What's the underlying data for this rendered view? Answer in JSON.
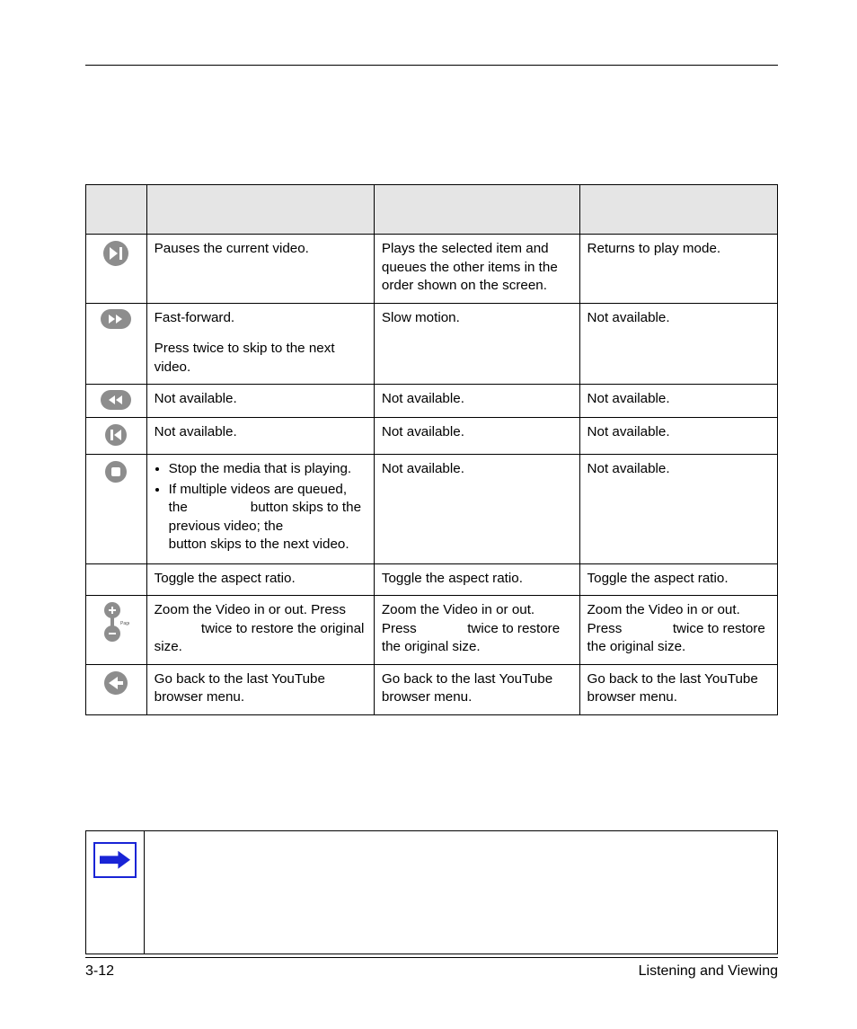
{
  "footer": {
    "page_num": "3-12",
    "section": "Listening and Viewing"
  },
  "table": {
    "rows": [
      {
        "icon": "play-pause",
        "c2_p1": "Pauses the current video.",
        "c3": "Plays the selected item and queues the other items in the order shown on the screen.",
        "c4": "Returns to play mode."
      },
      {
        "icon": "fast-forward",
        "c2_p1": "Fast-forward.",
        "c2_p2": "Press twice to skip to the next video.",
        "c3": "Slow motion.",
        "c4": "Not available."
      },
      {
        "icon": "rewind",
        "c2_p1": "Not available.",
        "c3": "Not available.",
        "c4": "Not available."
      },
      {
        "icon": "skip-prev",
        "c2_p1": "Not available.",
        "c3": "Not available.",
        "c4": "Not available."
      },
      {
        "icon": "stop",
        "c2_bullets": {
          "b1": "Stop the media that is playing.",
          "b2_a": "If multiple videos are queued, the",
          "b2_b": "button skips to the previous video; the",
          "b2_c": "button skips to the next video."
        },
        "c3": "Not available.",
        "c4": "Not available."
      },
      {
        "icon": "none",
        "c2_p1": "Toggle the aspect ratio.",
        "c3": "Toggle the aspect ratio.",
        "c4": "Toggle the aspect ratio."
      },
      {
        "icon": "zoom",
        "c2_zoom_a": "Zoom the Video in or out. Press",
        "c2_zoom_b": "twice to restore the original size.",
        "c3_zoom_a": "Zoom the Video in or out. Press",
        "c3_zoom_b": "twice to restore the original size.",
        "c4_zoom_a": "Zoom the Video in or out. Press",
        "c4_zoom_b": "twice to restore the original size."
      },
      {
        "icon": "back",
        "c2_p1": "Go back to the last YouTube browser menu.",
        "c3": "Go back to the last YouTube browser menu.",
        "c4": "Go back to the last YouTube browser menu."
      }
    ]
  },
  "icons": {
    "zoom_label": "Page"
  }
}
